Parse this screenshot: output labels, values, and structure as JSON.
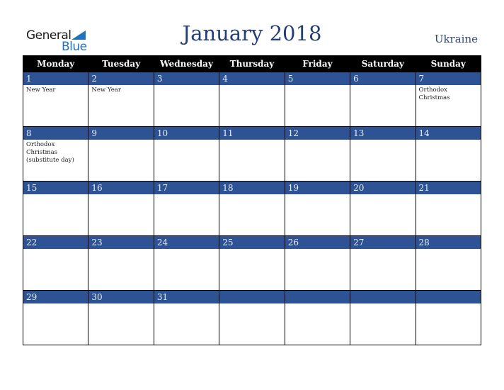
{
  "logo": {
    "line1": "General",
    "line2": "Blue",
    "icon": "triangle-flag-icon"
  },
  "title": "January 2018",
  "country": "Ukraine",
  "weekdays": [
    "Monday",
    "Tuesday",
    "Wednesday",
    "Thursday",
    "Friday",
    "Saturday",
    "Sunday"
  ],
  "colors": {
    "header_bg": "#000000",
    "daynum_bg": "#2d5394",
    "title": "#243f73",
    "logo_blue": "#1e73be"
  },
  "weeks": [
    [
      {
        "day": "1",
        "holiday": "New Year"
      },
      {
        "day": "2",
        "holiday": "New Year"
      },
      {
        "day": "3",
        "holiday": ""
      },
      {
        "day": "4",
        "holiday": ""
      },
      {
        "day": "5",
        "holiday": ""
      },
      {
        "day": "6",
        "holiday": ""
      },
      {
        "day": "7",
        "holiday": "Orthodox Christmas"
      }
    ],
    [
      {
        "day": "8",
        "holiday": "Orthodox Christmas (substitute day)"
      },
      {
        "day": "9",
        "holiday": ""
      },
      {
        "day": "10",
        "holiday": ""
      },
      {
        "day": "11",
        "holiday": ""
      },
      {
        "day": "12",
        "holiday": ""
      },
      {
        "day": "13",
        "holiday": ""
      },
      {
        "day": "14",
        "holiday": ""
      }
    ],
    [
      {
        "day": "15",
        "holiday": ""
      },
      {
        "day": "16",
        "holiday": ""
      },
      {
        "day": "17",
        "holiday": ""
      },
      {
        "day": "18",
        "holiday": ""
      },
      {
        "day": "19",
        "holiday": ""
      },
      {
        "day": "20",
        "holiday": ""
      },
      {
        "day": "21",
        "holiday": ""
      }
    ],
    [
      {
        "day": "22",
        "holiday": ""
      },
      {
        "day": "23",
        "holiday": ""
      },
      {
        "day": "24",
        "holiday": ""
      },
      {
        "day": "25",
        "holiday": ""
      },
      {
        "day": "26",
        "holiday": ""
      },
      {
        "day": "27",
        "holiday": ""
      },
      {
        "day": "28",
        "holiday": ""
      }
    ],
    [
      {
        "day": "29",
        "holiday": ""
      },
      {
        "day": "30",
        "holiday": ""
      },
      {
        "day": "31",
        "holiday": ""
      },
      {
        "day": "",
        "holiday": ""
      },
      {
        "day": "",
        "holiday": ""
      },
      {
        "day": "",
        "holiday": ""
      },
      {
        "day": "",
        "holiday": ""
      }
    ]
  ]
}
